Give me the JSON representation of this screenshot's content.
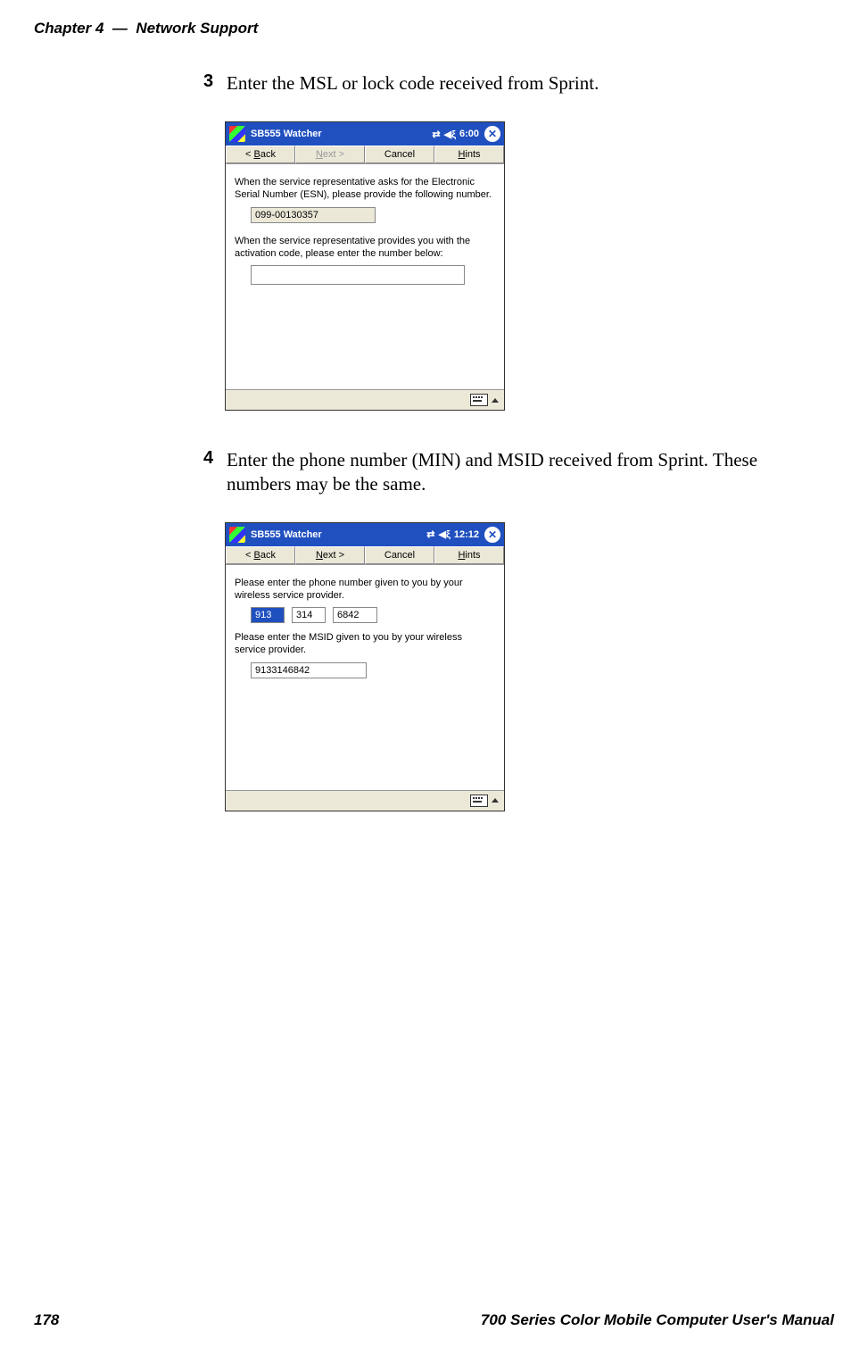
{
  "header": {
    "chapter": "Chapter 4",
    "sep": "—",
    "title": "Network Support"
  },
  "footer": {
    "page": "178",
    "manual": "700 Series Color Mobile Computer User's Manual"
  },
  "steps": {
    "s3": {
      "num": "3",
      "text": "Enter the MSL or lock code received from Sprint."
    },
    "s4": {
      "num": "4",
      "text": "Enter the phone number (MIN) and MSID received from Sprint. These numbers may be the same."
    }
  },
  "screen1": {
    "title": "SB555 Watcher",
    "clock": "6:00",
    "close": "✕",
    "buttons": {
      "back": "< Back",
      "next": "Next >",
      "cancel": "Cancel",
      "hints": "Hints"
    },
    "para1": "When the service representative asks for the Electronic Serial Number (ESN), please provide the following number.",
    "esn": "099-00130357",
    "para2": "When the service representative provides you with the activation code, please enter the number below:",
    "code": ""
  },
  "screen2": {
    "title": "SB555 Watcher",
    "clock": "12:12",
    "close": "✕",
    "buttons": {
      "back": "< Back",
      "next": "Next >",
      "cancel": "Cancel",
      "hints": "Hints"
    },
    "para1": "Please enter the phone number given to you by your wireless service provider.",
    "phone": {
      "p1": "913",
      "p2": "314",
      "p3": "6842"
    },
    "para2": "Please enter the MSID given to you by your wireless service provider.",
    "msid": "9133146842"
  },
  "icons": {
    "conn": "⇄",
    "sound": "◀ξ"
  }
}
